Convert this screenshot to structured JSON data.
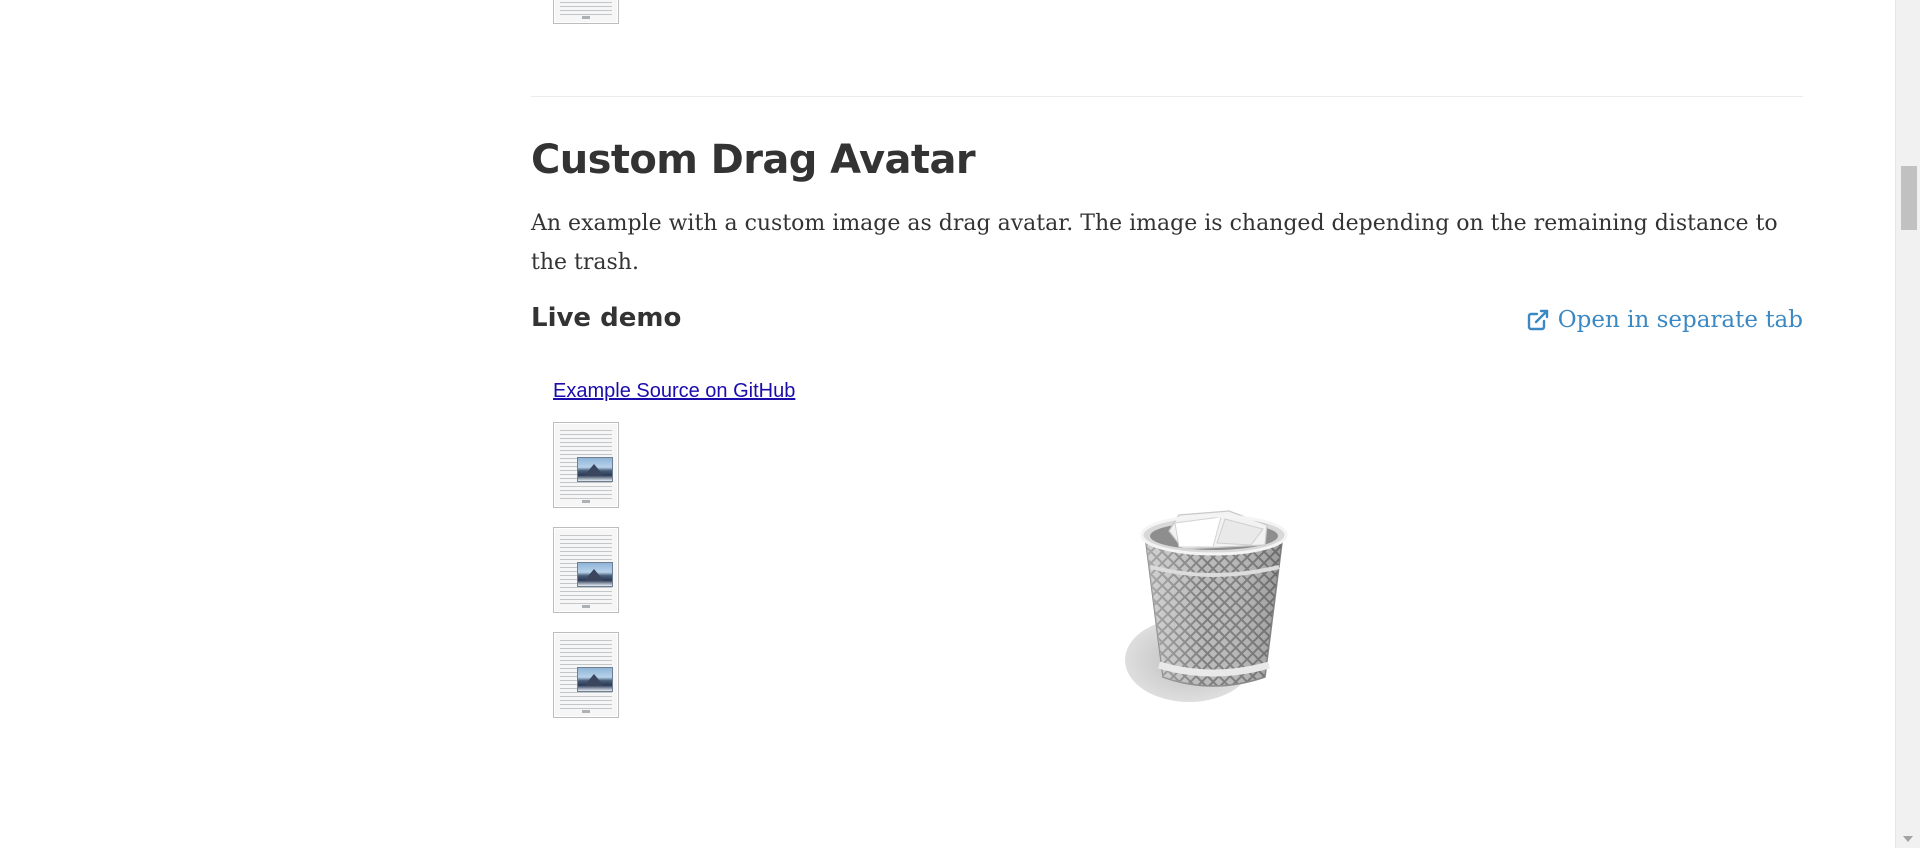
{
  "section": {
    "title": "Custom Drag Avatar",
    "description": "An example with a custom image as drag avatar. The image is changed depending on the remaining distance to the trash."
  },
  "demo": {
    "live_demo_label": "Live demo",
    "open_tab_label": "Open in separate tab",
    "github_link_label": "Example Source on GitHub",
    "documents": [
      "document",
      "document",
      "document"
    ]
  },
  "icons": {
    "open_tab": "external-link-icon",
    "trash": "trash-bin-icon"
  },
  "colors": {
    "link_accent": "#3b88c3",
    "github_link": "#1a0dab",
    "text": "#333333"
  }
}
